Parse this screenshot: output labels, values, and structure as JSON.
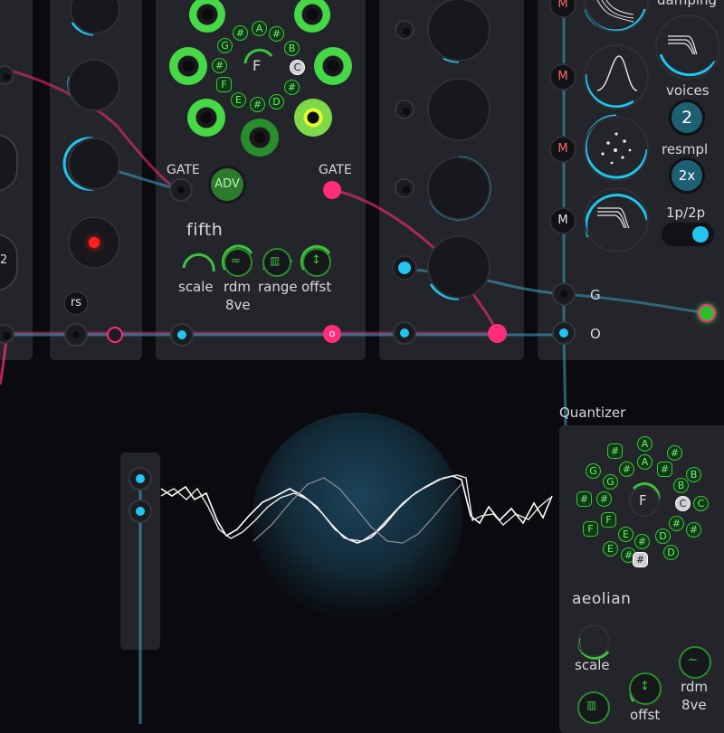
{
  "colors": {
    "accent_cyan": "#22c4f0",
    "accent_pink": "#ff2d7a",
    "accent_green": "#3ec23e",
    "panel": "#23252b",
    "background": "#0b0b0f"
  },
  "chord_module": {
    "gate_left": "GATE",
    "adv_button": "ADV",
    "gate_right": "GATE",
    "chord_name": "fifth",
    "root_note": "F",
    "note_labels": [
      "A",
      "#",
      "B",
      "C",
      "#",
      "D",
      "#",
      "E",
      "F",
      "#",
      "G",
      "#"
    ],
    "controls": [
      "scale",
      "rdm",
      "range",
      "offst"
    ],
    "rdm_sub": "8ve",
    "out_label": "o"
  },
  "left_module": {
    "rs_label": "rs",
    "cut_label": "2"
  },
  "resonator_module": {
    "damping_label": "damping",
    "voices_label": "voices",
    "voices_value": "2",
    "resmpl_label": "resmpl",
    "resmpl_value": "2x",
    "mode_label": "1p/2p",
    "m_buttons": [
      "M",
      "M",
      "M",
      "M"
    ],
    "gate_label": "G",
    "out_label": "O"
  },
  "quantizer": {
    "title": "Quantizer",
    "root_note": "F",
    "scale_name": "aeolian",
    "note_labels": [
      "A",
      "#",
      "B",
      "C",
      "D",
      "#",
      "E",
      "F",
      "G",
      "#"
    ],
    "scale_label": "scale",
    "rdm_label": "rdm",
    "rdm_sub": "8ve",
    "offst_label": "offst"
  }
}
